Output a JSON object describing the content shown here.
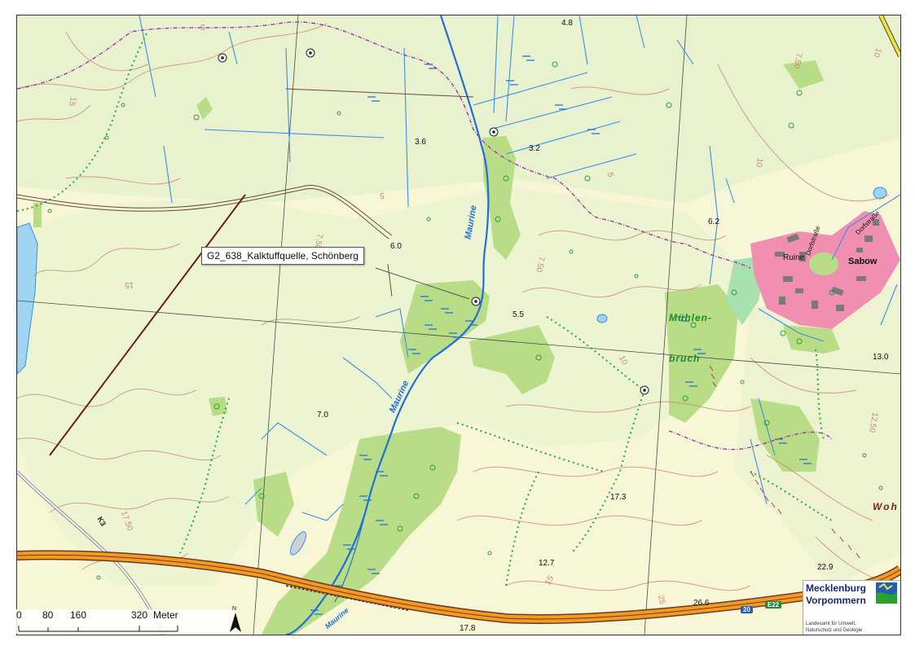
{
  "callout": {
    "label": "G2_638_Kalktuffquelle, Schönberg"
  },
  "elevations": [
    {
      "id": "e48",
      "text": "4.8"
    },
    {
      "id": "e36",
      "text": "3.6"
    },
    {
      "id": "e32",
      "text": "3.2"
    },
    {
      "id": "e62",
      "text": "6.2"
    },
    {
      "id": "e60",
      "text": "6.0"
    },
    {
      "id": "e55",
      "text": "5.5"
    },
    {
      "id": "e130",
      "text": "13.0"
    },
    {
      "id": "e70",
      "text": "7.0"
    },
    {
      "id": "e173",
      "text": "17.3"
    },
    {
      "id": "e127",
      "text": "12.7"
    },
    {
      "id": "e229",
      "text": "22.9"
    },
    {
      "id": "e266",
      "text": "26.6"
    },
    {
      "id": "e178",
      "text": "17.8"
    }
  ],
  "contour_labels": [
    "5",
    "5",
    "15",
    "7.50",
    "10",
    "7.50",
    "10",
    "12.50",
    "17.50",
    "15",
    "25",
    "10",
    "7.50",
    "5",
    "15"
  ],
  "river_labels": [
    "Maurine",
    "Maurine",
    "Maurine"
  ],
  "area_labels": {
    "wetland_1": "Mühlen-",
    "wetland_2": "bruch"
  },
  "places": {
    "village": "Sabow",
    "ruin": "Ruine",
    "street": "Dorfstraße",
    "street2": "Dorfstraße"
  },
  "field_label": "Woh",
  "roads": {
    "k3": "K3",
    "route_num": "20",
    "euro_route": "E22"
  },
  "scale_bar": {
    "ticks": [
      "0",
      "80",
      "160",
      "320"
    ],
    "unit": "Meter"
  },
  "north_arrow": {
    "label": "N"
  },
  "logo": {
    "line1": "Mecklenburg",
    "line2": "Vorpommern",
    "sub1": "Landesamt für Umwelt,",
    "sub2": "Naturschutz und Geologie"
  },
  "colors": {
    "background": "#f7f6d6",
    "meadow": "#e8f2cf",
    "forest": "#b9dc86",
    "water": "#3a8ee6",
    "settlement": "#f08fb2",
    "contour": "#c98a6a",
    "motorway": "#f39a1f",
    "boundary": "#9a3fa0",
    "path_dotted": "#1fae2b",
    "grid": "#4a4a4a"
  }
}
